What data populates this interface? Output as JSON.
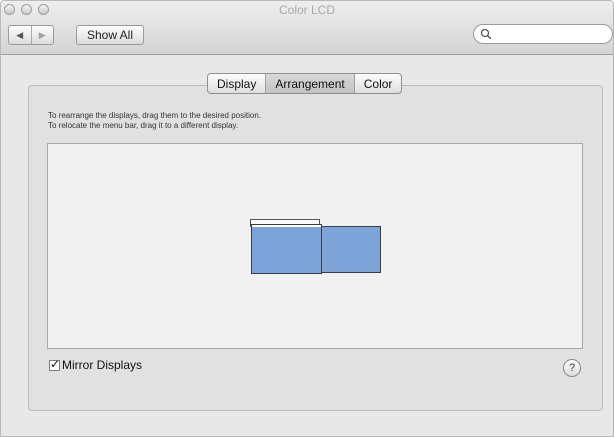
{
  "window": {
    "title": "Color LCD"
  },
  "toolbar": {
    "back_icon": "back-arrow-icon",
    "forward_icon": "forward-arrow-icon",
    "back_glyph": "◀",
    "forward_glyph": "▶",
    "show_all_label": "Show All",
    "search_icon": "search-icon",
    "search_placeholder": ""
  },
  "tabs": [
    {
      "label": "Display",
      "active": false
    },
    {
      "label": "Arrangement",
      "active": true
    },
    {
      "label": "Color",
      "active": false
    }
  ],
  "instructions": {
    "line1": "To rearrange the displays, drag them to the desired position.",
    "line2": "To relocate the menu bar, drag it to a different display."
  },
  "arrangement": {
    "display_color": "#7da4d9"
  },
  "mirror_displays": {
    "label": "Mirror Displays",
    "checked": true,
    "check_glyph": "✓"
  },
  "help": {
    "glyph": "?",
    "icon": "help-icon"
  }
}
